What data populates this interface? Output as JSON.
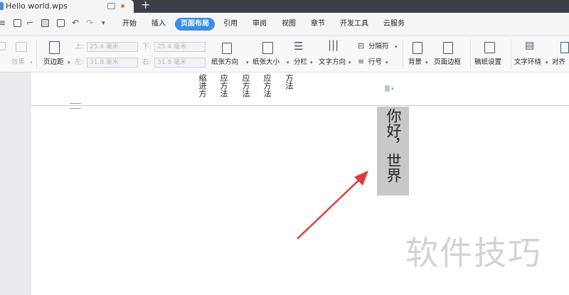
{
  "window": {
    "doc_tab_title": "Hello world.wps",
    "new_tab_glyph": "+"
  },
  "menu": {
    "tabs": [
      "开始",
      "插入",
      "页面布局",
      "引用",
      "审阅",
      "视图",
      "章节",
      "开发工具",
      "云服务"
    ],
    "active_tab": "页面布局"
  },
  "ribbon": {
    "effects": "效果",
    "margins": "页边距",
    "top_label": "上:",
    "top_value": "25.4 毫米",
    "bottom_label": "下:",
    "bottom_value": "25.4 毫米",
    "left_label": "左:",
    "left_value": "31.8 毫米",
    "right_label": "右:",
    "right_value": "31.8 毫米",
    "orientation": "纸张方向",
    "size": "纸张大小",
    "columns": "分栏",
    "text_direction": "文字方向",
    "separator": "分隔符",
    "line_numbers": "行号",
    "background": "背景",
    "page_border": "页面边框",
    "manuscript": "稿纸设置",
    "text_wrap": "文字环绕",
    "align": "对齐"
  },
  "document": {
    "header_columns": [
      "缩进方",
      "应方法",
      "应方法",
      "应方法",
      "方法"
    ],
    "hello_text": "你好，世界",
    "watermark": "软件技巧"
  },
  "colors": {
    "accent": "#3a8ee6",
    "titlebar": "#3c3f4a",
    "arrow": "#e03a3a",
    "selection": "#c8c8c8"
  }
}
